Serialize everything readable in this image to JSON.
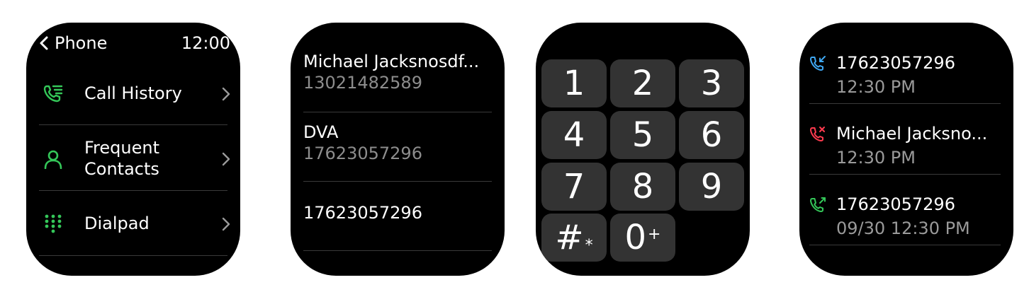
{
  "colors": {
    "accent_green": "#34c759",
    "missed_red": "#ff3b4f",
    "incoming_blue": "#3fa9f5"
  },
  "menu_screen": {
    "back_label": "Phone",
    "time": "12:00",
    "items": [
      {
        "label": "Call History",
        "icon": "call-history-icon"
      },
      {
        "label_line1": "Frequent",
        "label_line2": "Contacts",
        "icon": "contact-person-icon"
      },
      {
        "label": "Dialpad",
        "icon": "dialpad-grid-icon"
      }
    ]
  },
  "contacts_screen": {
    "contacts": [
      {
        "name": "Michael Jacksnosdf...",
        "number": "13021482589"
      },
      {
        "name": "DVA",
        "number": "17623057296"
      },
      {
        "name": "17623057296"
      }
    ]
  },
  "dialpad_screen": {
    "keys": [
      "1",
      "2",
      "3",
      "4",
      "5",
      "6",
      "7",
      "8",
      "9"
    ],
    "hash_key": {
      "main": "#",
      "sub": "*"
    },
    "zero_key": {
      "main": "0",
      "sub": "+"
    }
  },
  "history_screen": {
    "calls": [
      {
        "type": "incoming",
        "name": "17623057296",
        "time": "12:30 PM"
      },
      {
        "type": "missed",
        "name": "Michael Jacksno...",
        "time": "12:30 PM"
      },
      {
        "type": "outgoing",
        "name": "17623057296",
        "time": "09/30 12:30 PM"
      }
    ]
  }
}
